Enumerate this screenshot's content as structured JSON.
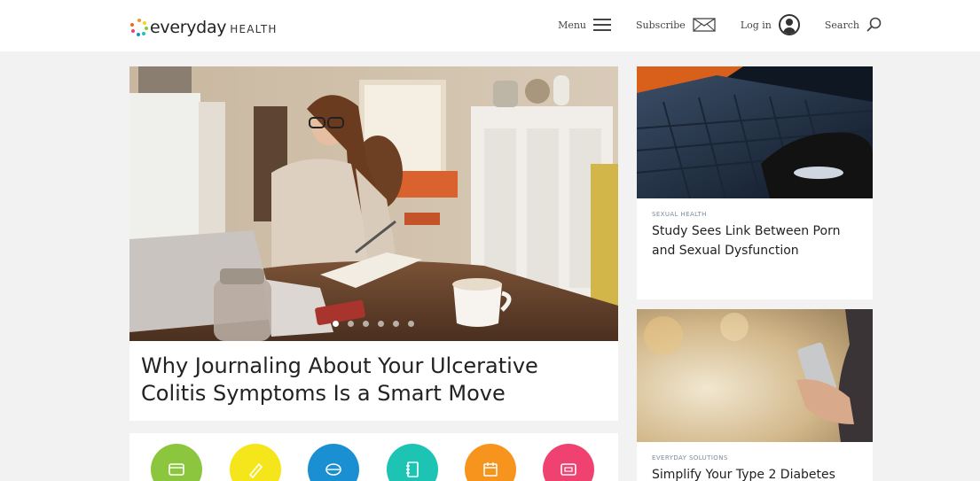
{
  "header": {
    "logo": {
      "word": "everyday",
      "health": "HEALTH"
    },
    "nav": {
      "menu_label": "Menu",
      "subscribe_label": "Subscribe",
      "login_label": "Log in",
      "search_label": "Search"
    }
  },
  "hero": {
    "title": "Why Journaling About Your Ulcerative Colitis Symptoms Is a Smart Move",
    "slides_count": 6,
    "active_slide": 1
  },
  "side_articles": [
    {
      "category": "SEXUAL HEALTH",
      "title": "Study Sees Link Between Porn and Sexual Dysfunction"
    },
    {
      "category": "EVERYDAY SOLUTIONS",
      "title": "Simplify Your Type 2 Diabetes"
    }
  ],
  "icon_row": [
    {
      "icon": "calendar-card-icon",
      "color": "#8cc63f"
    },
    {
      "icon": "pencil-icon",
      "color": "#f5e61c"
    },
    {
      "icon": "pill-icon",
      "color": "#1a8fd1"
    },
    {
      "icon": "notebook-icon",
      "color": "#1dc3b3"
    },
    {
      "icon": "calendar-icon",
      "color": "#f7941d"
    },
    {
      "icon": "screen-icon",
      "color": "#ef4270"
    }
  ],
  "colors": {
    "background": "#f2f2f2",
    "card": "#ffffff",
    "text": "#222222",
    "category": "#7a8aa0"
  }
}
